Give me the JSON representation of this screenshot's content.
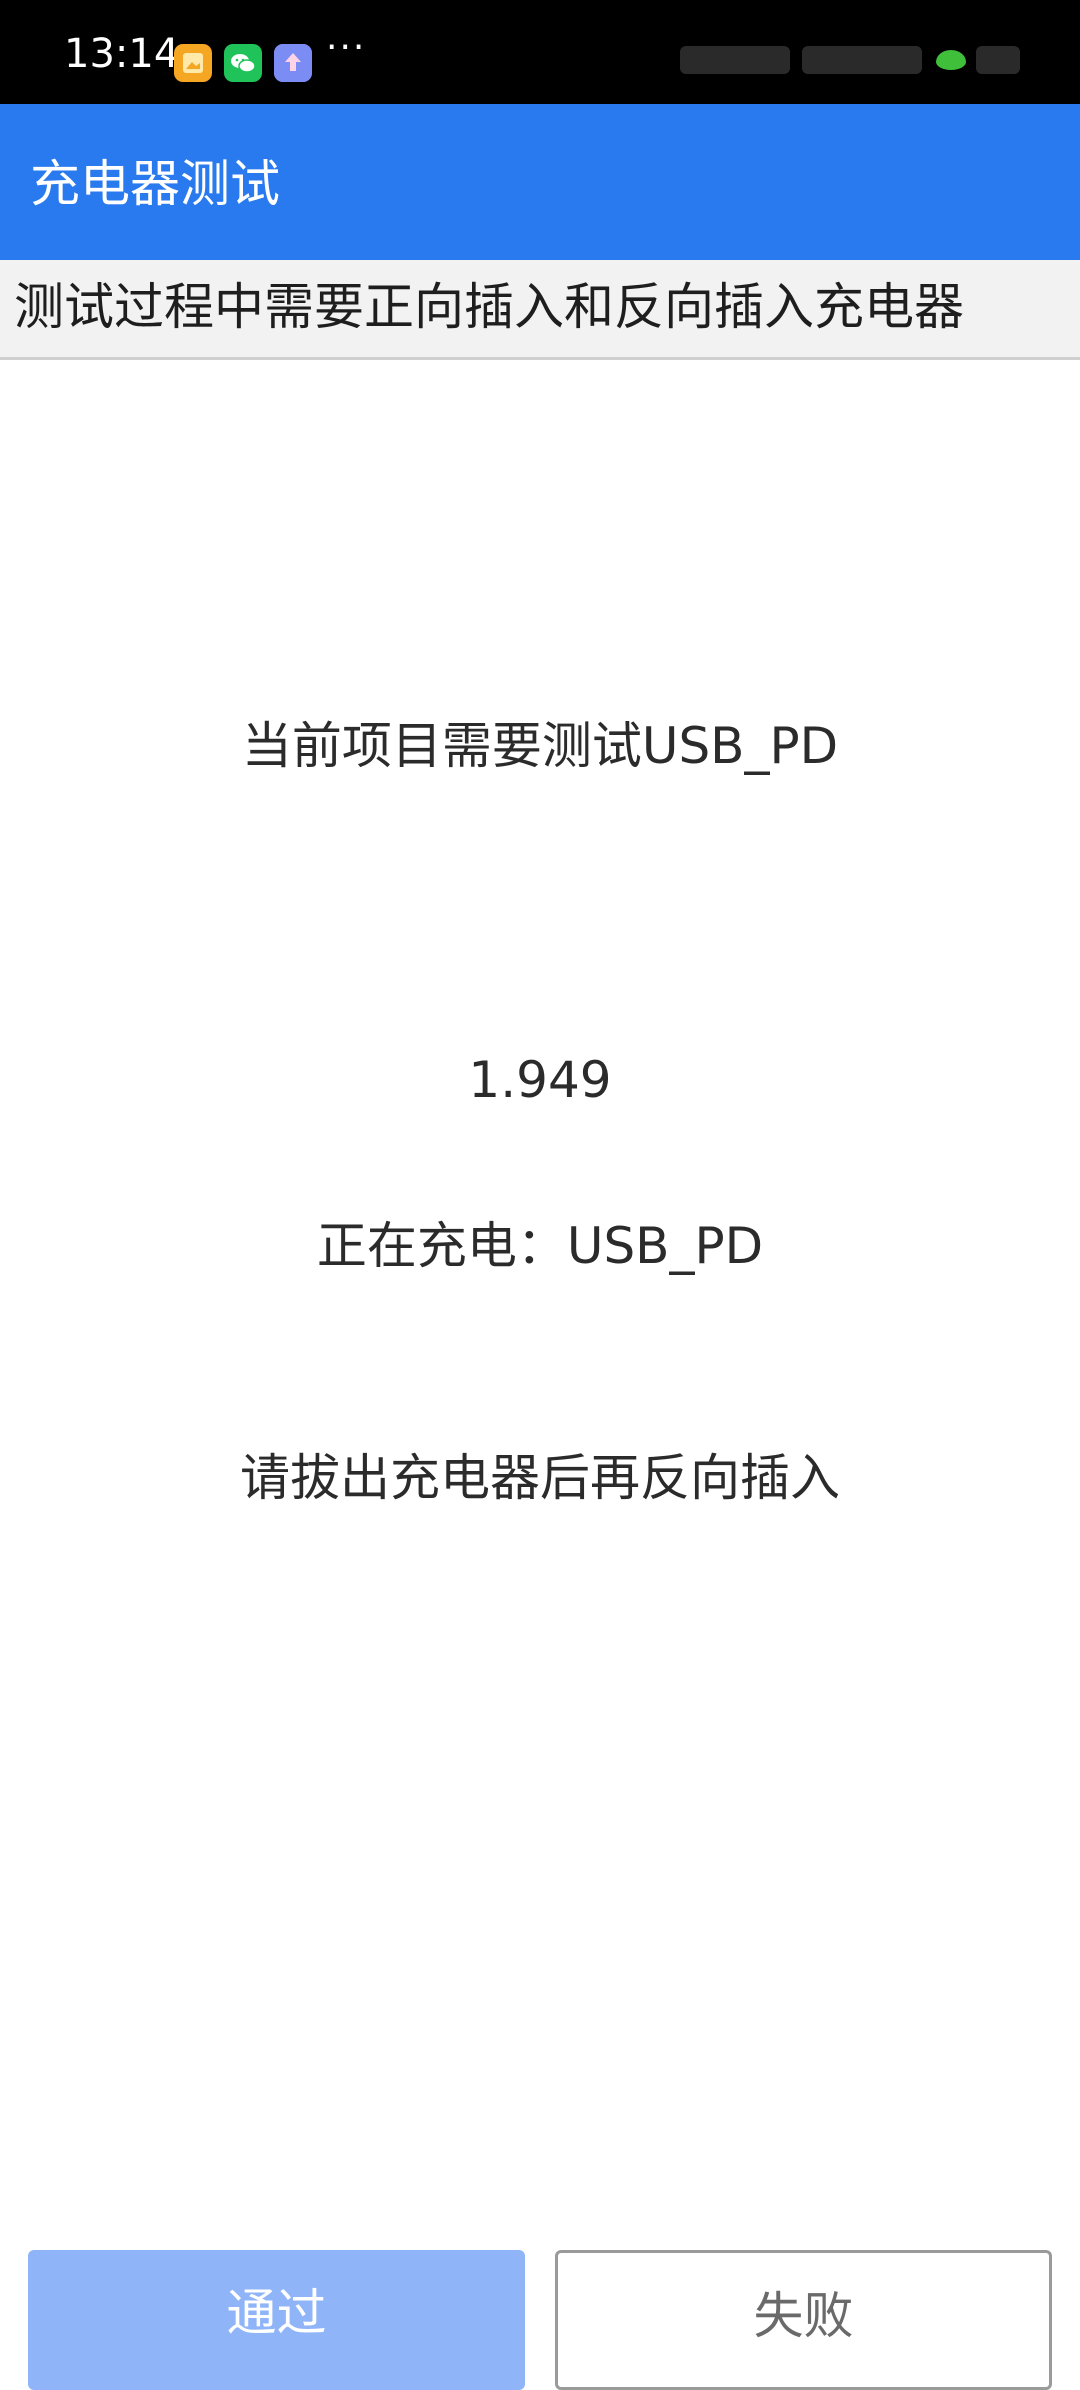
{
  "status_bar": {
    "time": "13:14",
    "notification_icons": [
      "gallery-icon",
      "wechat-icon",
      "upload-app-icon"
    ],
    "more_indicator": "···",
    "background": "#000000"
  },
  "app_bar": {
    "title": "充电器测试",
    "background": "#2979ef"
  },
  "hint": {
    "text": "测试过程中需要正向插入和反向插入充电器"
  },
  "main": {
    "required_item_text": "当前项目需要测试USB_PD",
    "reading_value": "1.949",
    "charging_status": "正在充电：USB_PD",
    "instruction": "请拔出充电器后再反向插入"
  },
  "buttons": {
    "pass_label": "通过",
    "fail_label": "失败",
    "pass_color": "#8fb5f8"
  }
}
